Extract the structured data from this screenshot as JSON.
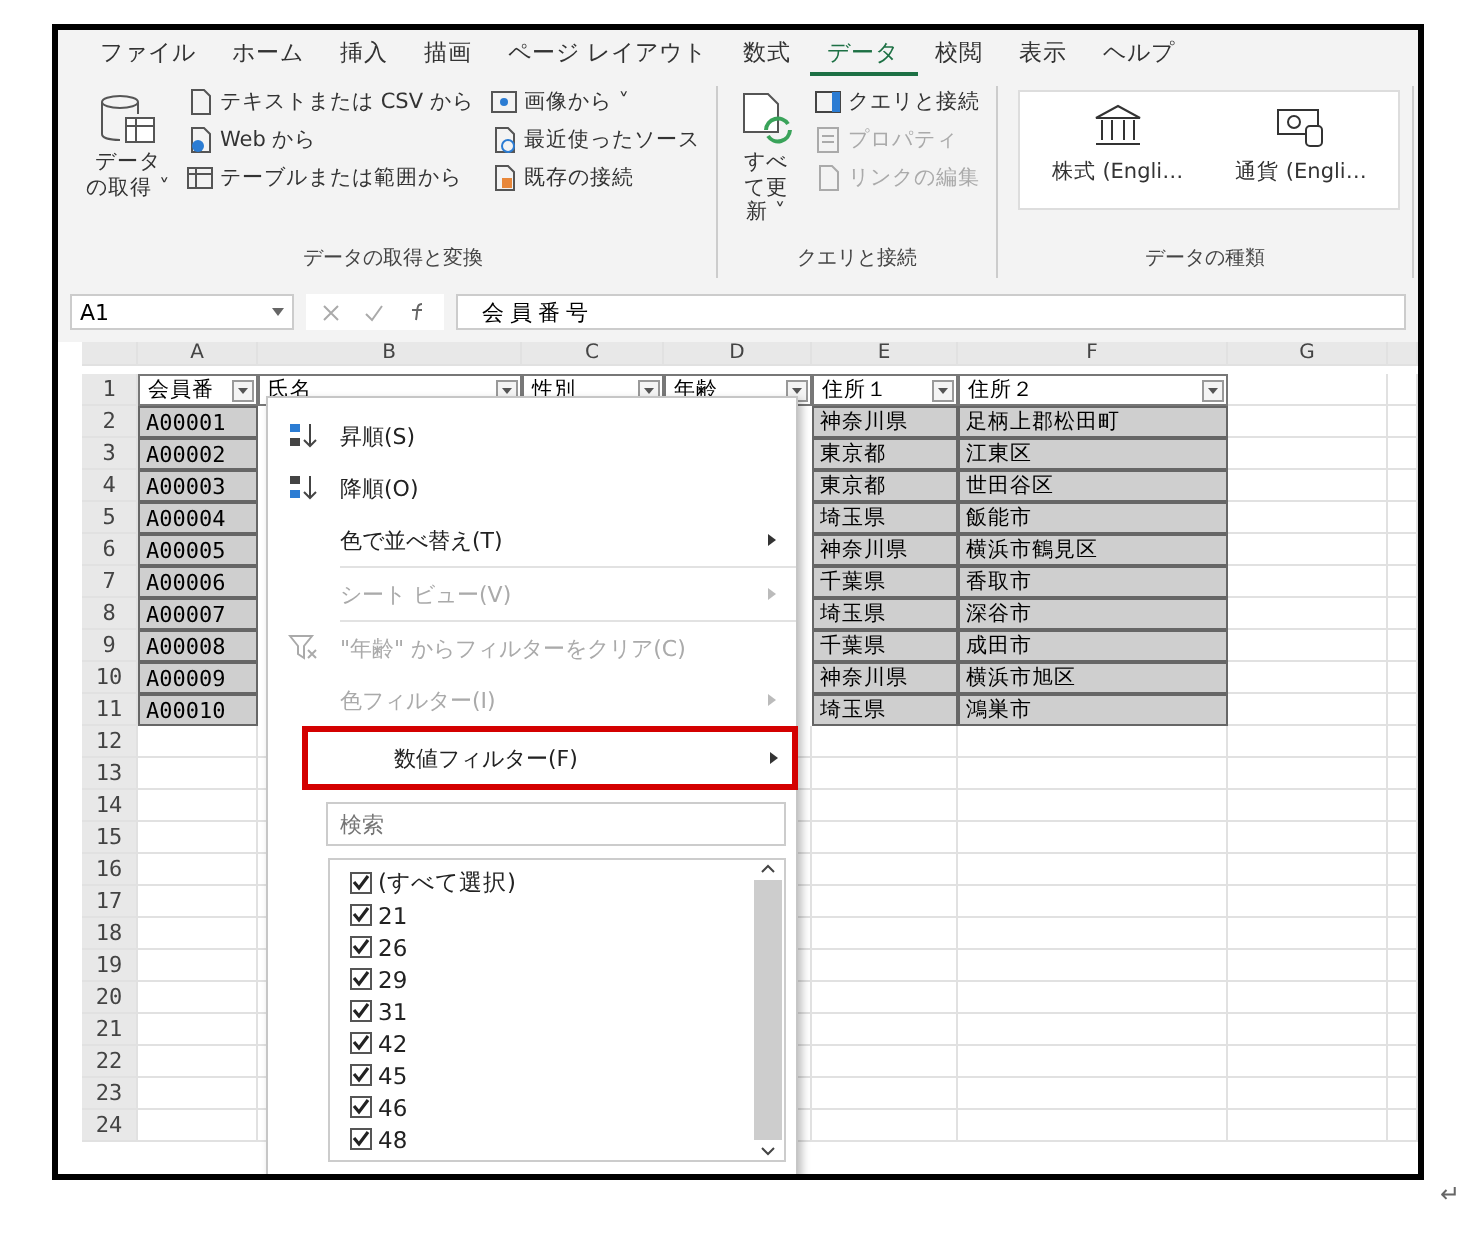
{
  "ribbon_tabs": [
    {
      "label": "ファイル",
      "selected": false
    },
    {
      "label": "ホーム",
      "selected": false
    },
    {
      "label": "挿入",
      "selected": false
    },
    {
      "label": "描画",
      "selected": false
    },
    {
      "label": "ページ レイアウト",
      "selected": false
    },
    {
      "label": "数式",
      "selected": false
    },
    {
      "label": "データ",
      "selected": true
    },
    {
      "label": "校閲",
      "selected": false
    },
    {
      "label": "表示",
      "selected": false
    },
    {
      "label": "ヘルプ",
      "selected": false
    }
  ],
  "ribbon_groups": [
    {
      "label": "データの取得と変換",
      "large_button": {
        "label": "データの取得 ˅",
        "kind": "database"
      },
      "columns": [
        [
          {
            "label": "テキストまたは CSV から",
            "kind": "document",
            "disabled": false
          },
          {
            "label": "Web から",
            "kind": "web",
            "disabled": false
          },
          {
            "label": "テーブルまたは範囲から",
            "kind": "table",
            "disabled": false
          }
        ],
        [
          {
            "label": "画像から ˅",
            "kind": "image",
            "disabled": false
          },
          {
            "label": "最近使ったソース",
            "kind": "recent",
            "disabled": false
          },
          {
            "label": "既存の接続",
            "kind": "connection",
            "disabled": false
          }
        ]
      ]
    },
    {
      "label": "クエリと接続",
      "large_button": {
        "label": "すべて更新 ˅",
        "kind": "refresh"
      },
      "columns": [
        [
          {
            "label": "クエリと接続",
            "kind": "panel",
            "disabled": false
          },
          {
            "label": "プロパティ",
            "kind": "properties",
            "disabled": true
          },
          {
            "label": "リンクの編集",
            "kind": "link",
            "disabled": true
          }
        ]
      ]
    },
    {
      "label": "データの種類",
      "gallery": [
        {
          "label": "株式 (Engli…",
          "kind": "bank"
        },
        {
          "label": "通貨 (Engli…",
          "kind": "currency"
        }
      ]
    }
  ],
  "formula_bar": {
    "name_box": "A1",
    "formula": "会員番号"
  },
  "column_headers": [
    "A",
    "B",
    "C",
    "D",
    "E",
    "F",
    "G"
  ],
  "header_row": {
    "number": "1",
    "cells": [
      "会員番",
      "氏名",
      "性別",
      "年齢",
      "住所１",
      "住所２"
    ]
  },
  "rows": [
    {
      "number": "2",
      "member_id": "A00001",
      "address_1": "神奈川県",
      "address_2": "足柄上郡松田町"
    },
    {
      "number": "3",
      "member_id": "A00002",
      "address_1": "東京都",
      "address_2": "江東区"
    },
    {
      "number": "4",
      "member_id": "A00003",
      "address_1": "東京都",
      "address_2": "世田谷区"
    },
    {
      "number": "5",
      "member_id": "A00004",
      "address_1": "埼玉県",
      "address_2": "飯能市"
    },
    {
      "number": "6",
      "member_id": "A00005",
      "address_1": "神奈川県",
      "address_2": "横浜市鶴見区"
    },
    {
      "number": "7",
      "member_id": "A00006",
      "address_1": "千葉県",
      "address_2": "香取市"
    },
    {
      "number": "8",
      "member_id": "A00007",
      "address_1": "埼玉県",
      "address_2": "深谷市"
    },
    {
      "number": "9",
      "member_id": "A00008",
      "address_1": "千葉県",
      "address_2": "成田市"
    },
    {
      "number": "10",
      "member_id": "A00009",
      "address_1": "神奈川県",
      "address_2": "横浜市旭区"
    },
    {
      "number": "11",
      "member_id": "A00010",
      "address_1": "埼玉県",
      "address_2": "鴻巣市"
    }
  ],
  "empty_row_numbers": [
    "12",
    "13",
    "14",
    "15",
    "16",
    "17",
    "18",
    "19",
    "20",
    "21",
    "22",
    "23",
    "24"
  ],
  "filter_menu": {
    "items": [
      {
        "label": "昇順(S)",
        "kind": "sort_ascending",
        "disabled": false,
        "submenu": false,
        "highlighted": false
      },
      {
        "label": "降順(O)",
        "kind": "sort_descending",
        "disabled": false,
        "submenu": false,
        "highlighted": false
      },
      {
        "label": "色で並べ替え(T)",
        "kind": "plain",
        "disabled": false,
        "submenu": true,
        "highlighted": false
      },
      {
        "label": "シート ビュー(V)",
        "kind": "plain",
        "disabled": true,
        "submenu": true,
        "highlighted": false
      },
      {
        "label": "\"年齢\" からフィルターをクリア(C)",
        "kind": "clear_filter",
        "disabled": true,
        "submenu": false,
        "highlighted": false
      },
      {
        "label": "色フィルター(I)",
        "kind": "plain",
        "disabled": true,
        "submenu": true,
        "highlighted": false
      },
      {
        "label": "数値フィルター(F)",
        "kind": "plain",
        "disabled": false,
        "submenu": true,
        "highlighted": true
      }
    ],
    "search": {
      "placeholder": "検索"
    },
    "values": [
      {
        "label": "(すべて選択)",
        "checked": true
      },
      {
        "label": "21",
        "checked": true
      },
      {
        "label": "26",
        "checked": true
      },
      {
        "label": "29",
        "checked": true
      },
      {
        "label": "31",
        "checked": true
      },
      {
        "label": "42",
        "checked": true
      },
      {
        "label": "45",
        "checked": true
      },
      {
        "label": "46",
        "checked": true
      },
      {
        "label": "48",
        "checked": true
      }
    ]
  },
  "paragraph_mark": "↵"
}
